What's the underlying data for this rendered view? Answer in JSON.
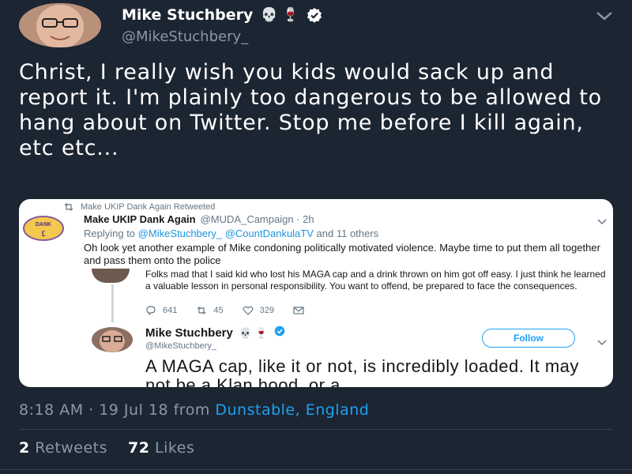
{
  "author": {
    "display_name": "Mike Stuchbery",
    "name_emoji": "💀 🍷",
    "handle": "@MikeStuchbery_"
  },
  "tweet": {
    "text": "Christ, I really wish you kids would sack up and report it. I'm plainly too dangerous to be allowed to hang about on Twitter. Stop me before I kill again, etc etc..."
  },
  "embedded": {
    "retweet_line": "Make UKIP Dank Again Retweeted",
    "logo_text": "DANK",
    "name": "Make UKIP Dank Again",
    "handle_time": "@MUDA_Campaign · 2h",
    "replying_prefix": "Replying to",
    "reply_mention_1": "@MikeStuchbery_",
    "reply_mention_2": "@CountDankulaTV",
    "replying_suffix": "and 11 others",
    "body": "Oh look yet another example of Mike condoning politically motivated violence. Maybe time to put them all together and pass them onto the police",
    "inner_tweet_text": "Folks mad that I said kid who lost his MAGA cap and a drink thrown on him got off easy. I just think he learned a valuable lesson in personal responsibility. You want to offend, be prepared to face the consequences.",
    "reply_count": "641",
    "retweet_count": "45",
    "like_count": "329",
    "inner2_name": "Mike Stuchbery",
    "inner2_emoji": "💀 🍷",
    "inner2_handle": "@MikeStuchbery_",
    "follow_label": "Follow",
    "inner2_text": "A MAGA cap, like it or not, is incredibly loaded. It may not be a Klan hood, or a"
  },
  "meta": {
    "time_date": "8:18 AM · 19 Jul 18 from",
    "location": "Dunstable, England"
  },
  "stats": {
    "retweets_count": "2",
    "retweets_label": "Retweets",
    "likes_count": "72",
    "likes_label": "Likes"
  },
  "colors": {
    "background": "#1c2532",
    "accent": "#1da1f2",
    "muted": "#8899a6"
  }
}
